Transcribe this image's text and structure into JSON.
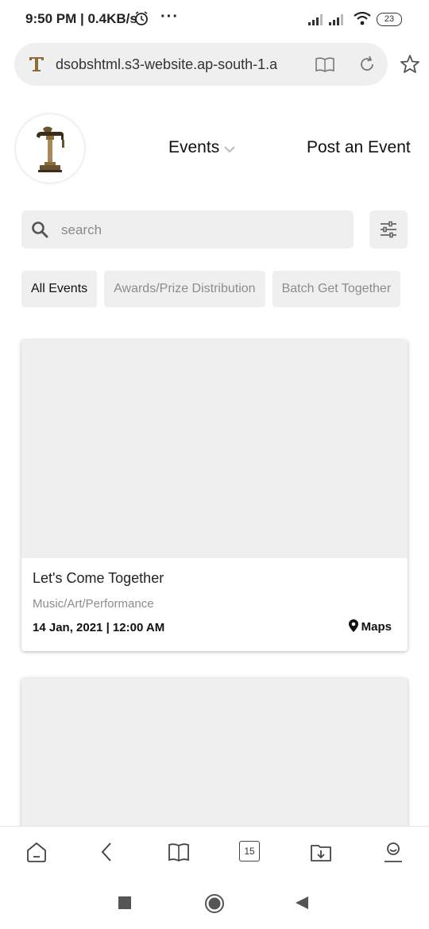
{
  "status_bar": {
    "time": "9:50 PM",
    "net_speed": "0.4KB/s",
    "more": "···",
    "battery": "23"
  },
  "browser": {
    "url": "dsobshtml.s3-website.ap-south-1.a",
    "tab_count": "15"
  },
  "nav": {
    "events_label": "Events",
    "post_event_label": "Post an Event"
  },
  "search": {
    "placeholder": "search",
    "value": ""
  },
  "categories": [
    "All Events",
    "Awards/Prize Distribution",
    "Batch Get Together"
  ],
  "events": [
    {
      "title": "Let's Come Together",
      "category": "Music/Art/Performance",
      "datetime": "14 Jan, 2021 | 12:00 AM",
      "maps_label": "Maps"
    }
  ],
  "colors": {
    "surface_gray": "#efefef",
    "muted_text": "#8c8c8c",
    "logo_brown": "#8a6d3b"
  }
}
